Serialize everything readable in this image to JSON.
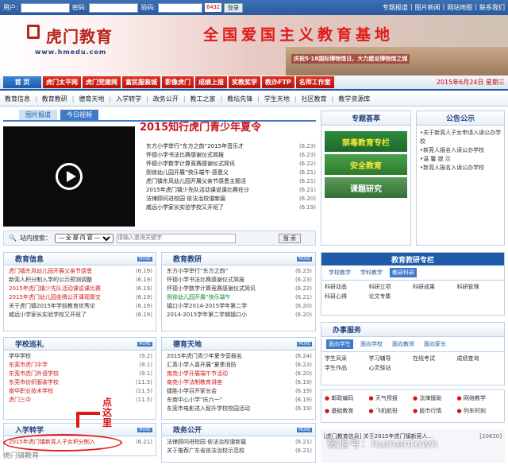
{
  "login": {
    "user_label": "用户:",
    "pwd_label": "密码:",
    "code_label": "验码:",
    "code": "6432",
    "btn": "登录",
    "links": [
      "专题报道",
      "图片新闻",
      "网站地图",
      "联系我们"
    ],
    "sep": "|"
  },
  "banner": {
    "logo_cn": "虎门教育",
    "url": "www.hmedu.com",
    "slogan": "全国爱国主义教育基地",
    "museum": "庆祝5·18国际博物馆日，大力建设博物馆之城"
  },
  "nav": {
    "items": [
      "首 页",
      "虎门太平网",
      "虎门党建网",
      "富民服装城",
      "影像虎门",
      "成绩上报",
      "奖教奖学",
      "教办FTP",
      "名师工作室"
    ],
    "date": "2015年6月24日 星期三"
  },
  "subnav": [
    "教育信息",
    "教育教研",
    "德育天地",
    "入学转学",
    "政务公开",
    "教工之家",
    "教坛先锋",
    "学生天地",
    "社区教育",
    "教学资源库"
  ],
  "tabs": [
    "图片报道",
    "今日视频"
  ],
  "headline": "2015知行虎门青少年夏令",
  "news": [
    {
      "t": "东方小学举行“东方之韵”2015年音乐才",
      "d": "(6.23)"
    },
    {
      "t": "怀德小学书法比赛感谢仪式简报",
      "d": "(6.23)"
    },
    {
      "t": "怀德小学数学计算竞赛感谢仪式简讯",
      "d": "(6.22)"
    },
    {
      "t": "则徐幼儿园开展“快乐端午·感恩父",
      "d": "(6.21)"
    },
    {
      "t": "虎门镇东风幼儿园开展父亲节感恩主题活",
      "d": "(6.21)"
    },
    {
      "t": "2015年虎门镇少先队活动课说课比赛在沙",
      "d": "(6.21)"
    },
    {
      "t": "法律顾问进校园 依法治校谱新篇",
      "d": "(6.20)"
    },
    {
      "t": "威远小学家长实验学校又开班了",
      "d": "(6.19)"
    }
  ],
  "search": {
    "label": "站内搜索：",
    "select": "— 全 部 内 容 —",
    "input": "请输入查询关键字",
    "btn": "搜 索"
  },
  "more": "MORE",
  "panels": {
    "jyxx": {
      "title": "教育信息",
      "rows": [
        {
          "t": "虎门镇东风幼儿园开展父亲节感恩",
          "d": "(6.19)",
          "c": "red"
        },
        {
          "t": "新莞人积分制入学的公示预测调整",
          "d": "(6.19)",
          "c": ""
        },
        {
          "t": "2015年虎门镇少先队活动课说课比赛",
          "d": "(6.19)",
          "c": "red"
        },
        {
          "t": "2015年虎门幼儿园金牌公开课观摩交",
          "d": "(6.19)",
          "c": "red"
        },
        {
          "t": "关于虎门镇2015年学前教育优秀论",
          "d": "(6.19)",
          "c": ""
        },
        {
          "t": "威远小学家长实验学校又开班了",
          "d": "(6.19)",
          "c": ""
        }
      ]
    },
    "jyjy": {
      "title": "教育教研",
      "rows": [
        {
          "t": "东方小学举行“东方之韵”",
          "d": "(6.23)",
          "c": ""
        },
        {
          "t": "怀德小学书法比赛感谢仪式简报",
          "d": "(6.23)",
          "c": ""
        },
        {
          "t": "怀德小学数学计算竞赛感谢仪式简讯",
          "d": "(6.22)",
          "c": ""
        },
        {
          "t": "则徐幼儿园开展“快乐端午",
          "d": "(6.21)",
          "c": "green"
        },
        {
          "t": "镇口小学2014-2015学年第二学",
          "d": "(6.20)",
          "c": ""
        },
        {
          "t": "2014-2015学年第二学期镇口小",
          "d": "(6.20)",
          "c": ""
        }
      ]
    },
    "xxxl": {
      "title": "学校巡礼",
      "rows": [
        {
          "t": "学华学校",
          "d": "(9.2)",
          "c": ""
        },
        {
          "t": "东莞市虎门中学",
          "d": "(9.1)",
          "c": "red"
        },
        {
          "t": "东莞市虎门外语学校",
          "d": "(9.1)",
          "c": "red"
        },
        {
          "t": "东莞市纺织服装学校",
          "d": "(11.5)",
          "c": "red"
        },
        {
          "t": "南华职业技术学校",
          "d": "(11.5)",
          "c": "red"
        },
        {
          "t": "虎门三中",
          "d": "(11.5)",
          "c": "red"
        }
      ]
    },
    "dytd": {
      "title": "德育天地",
      "rows": [
        {
          "t": "2015年虎门青少年夏令营报名",
          "d": "(6.24)",
          "c": ""
        },
        {
          "t": "汇英小学入喜开展“夏季消防",
          "d": "(6.23)",
          "c": ""
        },
        {
          "t": "南苑小学开展端午节活动",
          "d": "(6.20)",
          "c": "red"
        },
        {
          "t": "南苑小学法制教育讲座",
          "d": "(6.19)",
          "c": "red"
        },
        {
          "t": "捷胜小学召开家长会",
          "d": "(6.19)",
          "c": ""
        },
        {
          "t": "东南中心小学“庆六一”",
          "d": "(6.19)",
          "c": ""
        },
        {
          "t": "东莞市电影进入智升学校校园活动",
          "d": "(6.19)",
          "c": ""
        }
      ]
    },
    "rxzx": {
      "title": "入学转学",
      "rows": [
        {
          "t": "2015年虎门镇新莞人子女积分制入",
          "d": "(6.21)",
          "c": "red"
        }
      ]
    },
    "zwgk": {
      "title": "政务公开",
      "rows": [
        {
          "t": "法律顾问进校园 依法治校谱新篇",
          "d": "(6.21)",
          "c": ""
        },
        {
          "t": "关于推荐广东省依法治校示范校",
          "d": "(6.21)",
          "c": ""
        }
      ]
    }
  },
  "right": {
    "ztzs": "专题荟萃",
    "promos": [
      "禁毒教育专栏",
      "安全教育",
      "课题研究"
    ],
    "notice_title": "公告公示",
    "notices": [
      "•关于新莞人子女申请入读公办学校",
      "•新莞人报名入读公办学校",
      "•温 馨 提 示",
      "•新莞人报名入读公办学校"
    ],
    "jy_title": "教育教研专栏",
    "jy_tabs": [
      "学校教学",
      "学科教学",
      "教研科研"
    ],
    "jy_items": [
      "科研动态",
      "科研立项",
      "科研成果",
      "科研管理",
      "科研心得",
      "论文专集"
    ],
    "bs_title": "办事服务",
    "bs_tabs": [
      "面向学生",
      "面向学校",
      "面向教师",
      "面向家长"
    ],
    "bs_items": [
      "学生风采",
      "学习辅导",
      "在线考试",
      "成绩查询",
      "学生作品",
      "心灵驿站"
    ],
    "svc": [
      "邮政编码",
      "天气预报",
      "法律援助",
      "网络教学",
      "基础教育",
      "飞机航班",
      "股市行情",
      "列车时刻"
    ]
  },
  "bottom": {
    "news1": "[虎门教育信息] 关于2015年虎门镇新莞人...",
    "date": "[20620]"
  },
  "callout": "点这里",
  "watermark": "微信号：humentown",
  "watermark2": "虎门镇教育"
}
